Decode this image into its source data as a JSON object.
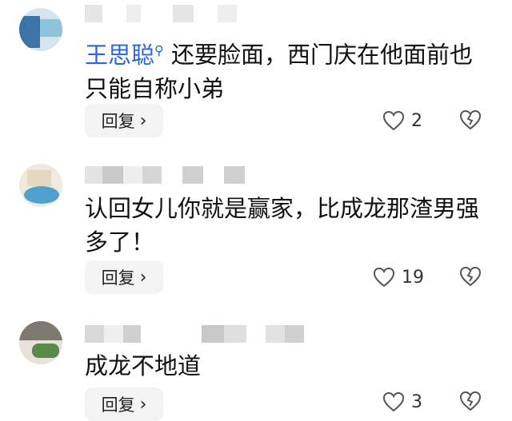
{
  "comments": [
    {
      "author": "王思聪",
      "lines": [
        "还要脸面，西门庆在他面前也",
        "只能自称小弟"
      ],
      "reply_label": "回复",
      "likes": "2",
      "like_icon": "heart-icon",
      "dislike_icon": "broken-heart-icon"
    },
    {
      "author": "",
      "lines": [
        "认回女儿你就是赢家，比成龙那渣男强",
        "多了！"
      ],
      "reply_label": "回复",
      "likes": "19",
      "like_icon": "heart-icon",
      "dislike_icon": "broken-heart-icon"
    },
    {
      "author": "",
      "lines": [
        "成龙不地道"
      ],
      "reply_label": "回复",
      "likes": "3",
      "like_icon": "heart-icon",
      "dislike_icon": "broken-heart-icon"
    }
  ],
  "colors": {
    "author_link": "#2b66d6",
    "reply_bg": "#f3f3f3"
  }
}
